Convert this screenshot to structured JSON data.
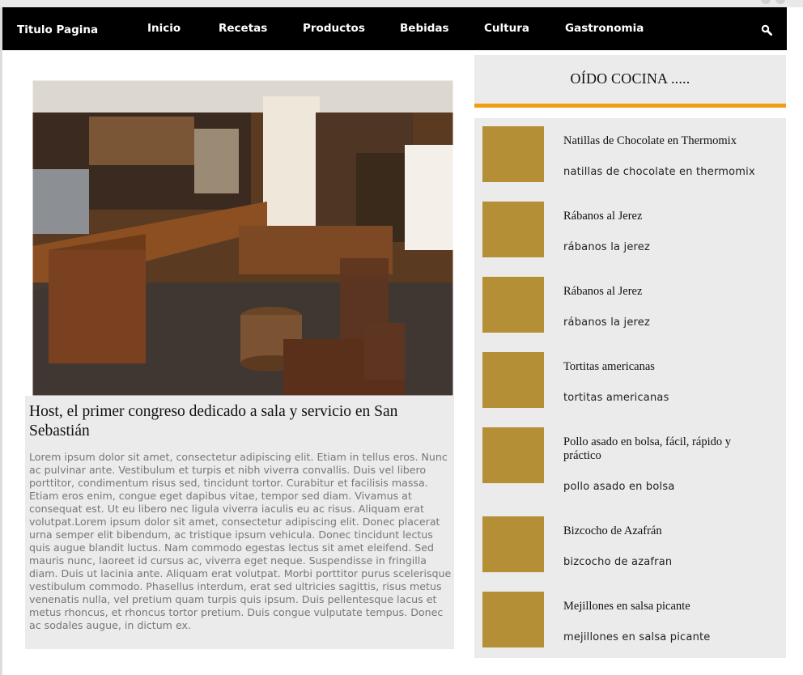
{
  "navbar": {
    "brand": "Titulo Pagina",
    "items": [
      "Inicio",
      "Recetas",
      "Productos",
      "Bebidas",
      "Cultura",
      "Gastronomia"
    ],
    "search_icon": "search-icon"
  },
  "article": {
    "title": "Host, el primer congreso dedicado a sala y servicio en San Sebastián",
    "body": "Lorem ipsum dolor sit amet, consectetur adipiscing elit. Etiam in tellus eros. Nunc ac pulvinar ante. Vestibulum et turpis et nibh viverra convallis. Duis vel libero porttitor, condimentum risus sed, tincidunt tortor. Curabitur et facilisis massa. Etiam eros enim, congue eget dapibus vitae, tempor sed diam. Vivamus at consequat est. Ut eu libero nec ligula viverra iaculis eu ac risus. Aliquam erat volutpat.Lorem ipsum dolor sit amet, consectetur adipiscing elit. Donec placerat urna semper elit bibendum, ac tristique ipsum vehicula. Donec tincidunt lectus quis augue blandit luctus. Nam commodo egestas lectus sit amet eleifend. Sed mauris nunc, laoreet id cursus ac, viverra eget neque. Suspendisse in fringilla diam. Duis ut lacinia ante. Aliquam erat volutpat. Morbi porttitor purus scelerisque vestibulum commodo. Phasellus interdum, erat sed ultricies sagittis, risus metus venenatis nulla, vel pretium quam turpis quis ipsum. Duis pellentesque lacus et metus rhoncus, et rhoncus tortor pretium. Duis congue vulputate tempus. Donec ac sodales augue, in dictum ex."
  },
  "sidebar": {
    "heading": "OÍDO COCINA .....",
    "accent_color": "#f39c12",
    "thumb_color": "#b58f36",
    "items": [
      {
        "title": "Natillas de Chocolate en Thermomix",
        "subtitle": "natillas de chocolate en thermomix"
      },
      {
        "title": "Rábanos al Jerez",
        "subtitle": "rábanos la jerez"
      },
      {
        "title": "Rábanos al Jerez",
        "subtitle": "rábanos la jerez"
      },
      {
        "title": "Tortitas americanas",
        "subtitle": "tortitas americanas"
      },
      {
        "title": "Pollo asado en bolsa, fácil, rápido y práctico",
        "subtitle": "pollo asado en bolsa"
      },
      {
        "title": "Bizcocho de Azafrán",
        "subtitle": "bizcocho de azafran"
      },
      {
        "title": "Mejillones en salsa picante",
        "subtitle": "mejillones en salsa picante"
      }
    ]
  }
}
